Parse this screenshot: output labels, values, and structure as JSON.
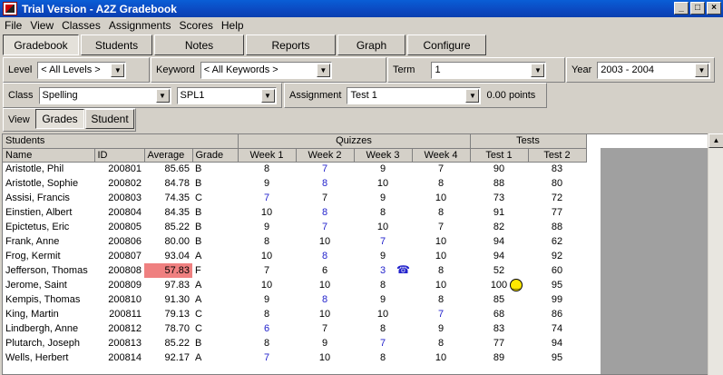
{
  "window": {
    "title": "Trial Version - A2Z Gradebook"
  },
  "menu": [
    "File",
    "View",
    "Classes",
    "Assignments",
    "Scores",
    "Help"
  ],
  "tabs": [
    "Gradebook",
    "Students",
    "Notes",
    "Reports",
    "Graph",
    "Configure"
  ],
  "filters": {
    "level_label": "Level",
    "level_value": "< All Levels >",
    "keyword_label": "Keyword",
    "keyword_value": "< All Keywords >",
    "term_label": "Term",
    "term_value": "1",
    "year_label": "Year",
    "year_value": "2003 - 2004",
    "class_label": "Class",
    "class_value": "Spelling",
    "section_value": "SPL1",
    "assignment_label": "Assignment",
    "assignment_value": "Test 1",
    "points_text": "0.00 points"
  },
  "view": {
    "label": "View",
    "grades": "Grades",
    "student": "Student"
  },
  "grid": {
    "group_headers": {
      "students": "Students",
      "quizzes": "Quizzes",
      "tests": "Tests"
    },
    "columns": [
      "Name",
      "ID",
      "Average",
      "Grade",
      "Week 1",
      "Week 2",
      "Week 3",
      "Week 4",
      "Test 1",
      "Test 2"
    ],
    "rows": [
      {
        "name": "Aristotle, Phil",
        "id": "200801",
        "avg": "85.65",
        "grade": "B",
        "w1": "8",
        "w2": "7",
        "w3": "9",
        "w4": "7",
        "t1": "90",
        "t2": "83",
        "blue": [
          "w2"
        ]
      },
      {
        "name": "Aristotle, Sophie",
        "id": "200802",
        "avg": "84.78",
        "grade": "B",
        "w1": "9",
        "w2": "8",
        "w3": "10",
        "w4": "8",
        "t1": "88",
        "t2": "80",
        "blue": [
          "w2"
        ]
      },
      {
        "name": "Assisi, Francis",
        "id": "200803",
        "avg": "74.35",
        "grade": "C",
        "w1": "7",
        "w2": "7",
        "w3": "9",
        "w4": "10",
        "t1": "73",
        "t2": "72",
        "blue": [
          "w1"
        ]
      },
      {
        "name": "Einstien, Albert",
        "id": "200804",
        "avg": "84.35",
        "grade": "B",
        "w1": "10",
        "w2": "8",
        "w3": "8",
        "w4": "8",
        "t1": "91",
        "t2": "77",
        "blue": [
          "w2"
        ]
      },
      {
        "name": "Epictetus, Eric",
        "id": "200805",
        "avg": "85.22",
        "grade": "B",
        "w1": "9",
        "w2": "7",
        "w3": "10",
        "w4": "7",
        "t1": "82",
        "t2": "88",
        "blue": [
          "w2"
        ]
      },
      {
        "name": "Frank, Anne",
        "id": "200806",
        "avg": "80.00",
        "grade": "B",
        "w1": "8",
        "w2": "10",
        "w3": "7",
        "w4": "10",
        "t1": "94",
        "t2": "62",
        "blue": [
          "w3"
        ]
      },
      {
        "name": "Frog, Kermit",
        "id": "200807",
        "avg": "93.04",
        "grade": "A",
        "w1": "10",
        "w2": "8",
        "w3": "9",
        "w4": "10",
        "t1": "94",
        "t2": "92",
        "blue": [
          "w2"
        ]
      },
      {
        "name": "Jefferson, Thomas",
        "id": "200808",
        "avg": "57.83",
        "grade": "F",
        "w1": "7",
        "w2": "6",
        "w3": "3",
        "w4": "8",
        "t1": "52",
        "t2": "60",
        "blue": [
          "w3"
        ],
        "flag": "low",
        "icon": "phone-icon"
      },
      {
        "name": "Jerome, Saint",
        "id": "200809",
        "avg": "97.83",
        "grade": "A",
        "w1": "10",
        "w2": "10",
        "w3": "8",
        "w4": "10",
        "t1": "100",
        "t2": "95",
        "blue": [],
        "icon2": "smiley-icon"
      },
      {
        "name": "Kempis, Thomas",
        "id": "200810",
        "avg": "91.30",
        "grade": "A",
        "w1": "9",
        "w2": "8",
        "w3": "9",
        "w4": "8",
        "t1": "85",
        "t2": "99",
        "blue": [
          "w2"
        ]
      },
      {
        "name": "King, Martin",
        "id": "200811",
        "avg": "79.13",
        "grade": "C",
        "w1": "8",
        "w2": "10",
        "w3": "10",
        "w4": "7",
        "t1": "68",
        "t2": "86",
        "blue": [
          "w4"
        ]
      },
      {
        "name": "Lindbergh, Anne",
        "id": "200812",
        "avg": "78.70",
        "grade": "C",
        "w1": "6",
        "w2": "7",
        "w3": "8",
        "w4": "9",
        "t1": "83",
        "t2": "74",
        "blue": [
          "w1"
        ]
      },
      {
        "name": "Plutarch, Joseph",
        "id": "200813",
        "avg": "85.22",
        "grade": "B",
        "w1": "8",
        "w2": "9",
        "w3": "7",
        "w4": "8",
        "t1": "77",
        "t2": "94",
        "blue": [
          "w3"
        ]
      },
      {
        "name": "Wells, Herbert",
        "id": "200814",
        "avg": "92.17",
        "grade": "A",
        "w1": "7",
        "w2": "10",
        "w3": "8",
        "w4": "10",
        "t1": "89",
        "t2": "95",
        "blue": [
          "w1"
        ]
      }
    ]
  },
  "colors": {
    "low_average": "#ef8080",
    "variant_score": "#2222cc",
    "title_bar": "#0b48c0"
  }
}
